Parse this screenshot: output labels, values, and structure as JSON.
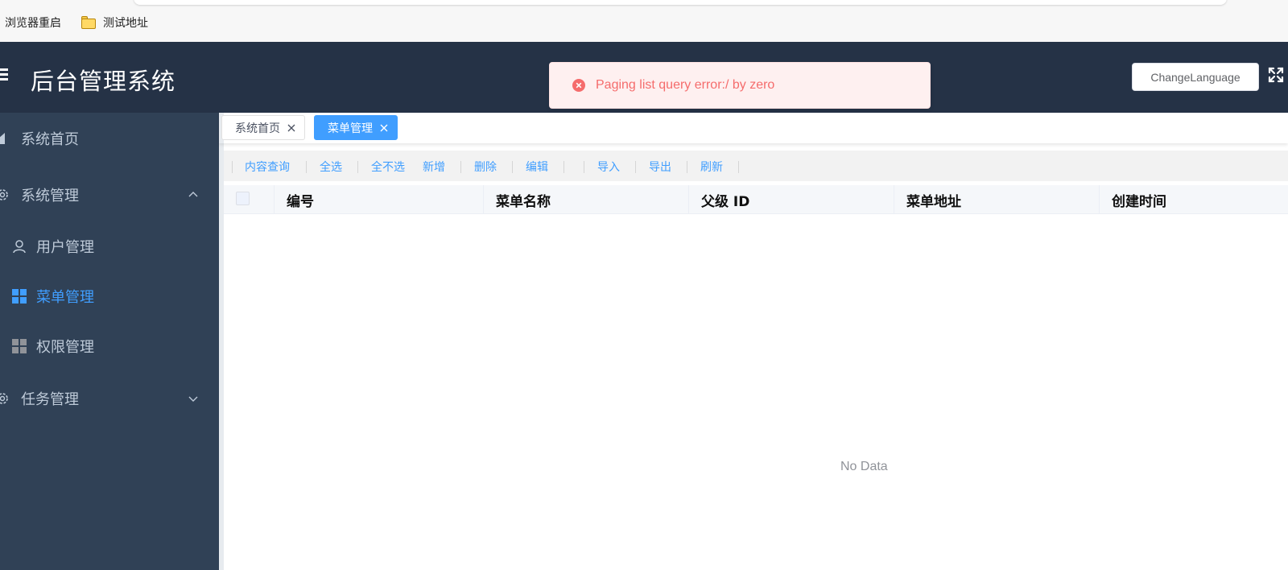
{
  "bookmarks": {
    "items": [
      {
        "label": "浏览器重启"
      },
      {
        "label": "测试地址"
      }
    ]
  },
  "header": {
    "title": "后台管理系统",
    "change_language_label": "ChangeLanguage",
    "background_color": "#253246"
  },
  "toast": {
    "type": "error",
    "message": "Paging list query error:/ by zero",
    "color": "#f56c6c"
  },
  "sidebar": {
    "background_color": "#304156",
    "active_color": "#409eff",
    "items": [
      {
        "label": "系统首页",
        "icon": "home-icon"
      },
      {
        "label": "系统管理",
        "icon": "gear-icon",
        "expanded": true
      },
      {
        "label": "用户管理",
        "icon": "user-icon"
      },
      {
        "label": "菜单管理",
        "icon": "grid-icon",
        "active": true
      },
      {
        "label": "权限管理",
        "icon": "grid-icon"
      },
      {
        "label": "任务管理",
        "icon": "gear-icon",
        "expanded": false
      }
    ]
  },
  "tags": [
    {
      "label": "系统首页",
      "active": false
    },
    {
      "label": "菜单管理",
      "active": true
    }
  ],
  "toolbar": {
    "buttons": [
      {
        "label": "内容查询"
      },
      {
        "label": "全选"
      },
      {
        "label": "全不选"
      },
      {
        "label": "新增"
      },
      {
        "label": "删除"
      },
      {
        "label": "编辑"
      },
      {
        "label": "导入"
      },
      {
        "label": "导出"
      },
      {
        "label": "刷新"
      }
    ]
  },
  "table": {
    "columns": [
      "编号",
      "菜单名称",
      "父级 ID",
      "菜单地址",
      "创建时间"
    ],
    "rows": [],
    "empty_text": "No Data"
  }
}
